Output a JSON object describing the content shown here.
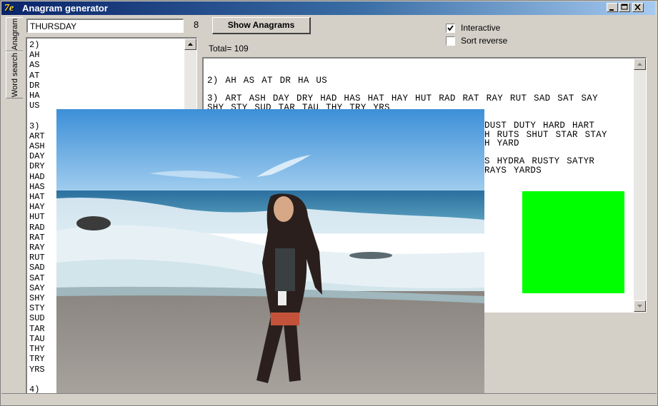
{
  "window": {
    "title": "Anagram generator",
    "icon": "anagram-app-icon",
    "accent_color": "#0a246a"
  },
  "tabs": [
    {
      "label": "Anagram",
      "selected": true
    },
    {
      "label": "Word search",
      "selected": false
    }
  ],
  "input": {
    "value": "THURSDAY",
    "letter_count": "8"
  },
  "buttons": {
    "show_anagrams": "Show Anagrams"
  },
  "total_label": "Total= 109",
  "options": {
    "interactive": {
      "label": "Interactive",
      "checked": true
    },
    "sort_reverse": {
      "label": "Sort reverse",
      "checked": false
    }
  },
  "word_list": "2)\nAH\nAS\nAT\nDR\nHA\nUS\n\n3)\nART\nASH\nDAY\nDRY\nHAD\nHAS\nHAT\nHAY\nHUT\nRAD\nRAT\nRAY\nRUT\nSAD\nSAT\nSAY\nSHY\nSTY\nSUD\nTAR\nTAU\nTHY\nTRY\nYRS\n\n4)",
  "results": [
    "2)  AH AS AT DR HA US",
    "3)  ART ASH DAY DRY HAD HAS HAT HAY HUT RAD RAT RAY RUT SAD SAT SAY SHY STY SUD TAR TAU THY TRY YRS",
    "DUST DUTY HARD HART\nH RUTS SHUT STAR STAY\nH YARD",
    "S HYDRA RUSTY SATYR\nRAYS YARDS"
  ],
  "colors": {
    "green_swatch": "#00ff00"
  }
}
